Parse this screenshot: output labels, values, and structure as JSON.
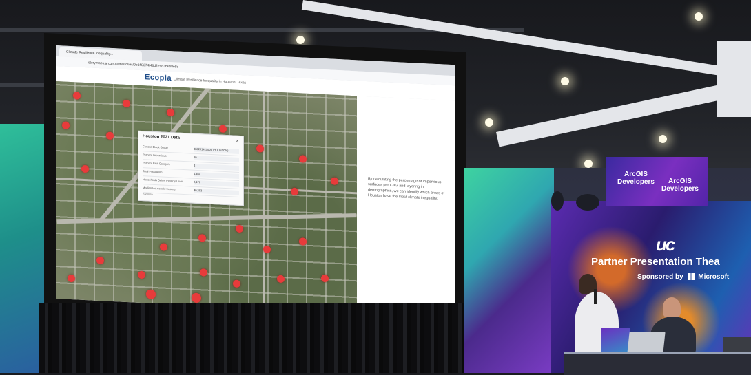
{
  "browser": {
    "tab_title": "Climate Resilience Inequality...",
    "url": "storymaps.arcgis.com/stories/9b1ff8274f46d2e9d3b6b8e8c"
  },
  "storymap": {
    "logo": "Ecopia",
    "title": "Climate Resilience Inequality in Houston, Texas"
  },
  "popup": {
    "title": "Houston 2021 Data",
    "rows": [
      {
        "label": "Census Block Group",
        "value": "480201421004 (HOUSTON)"
      },
      {
        "label": "Percent Impervious",
        "value": "80"
      },
      {
        "label": "Percent Risk Category",
        "value": "4"
      },
      {
        "label": "Total Population",
        "value": "1,450"
      },
      {
        "label": "Households Below Poverty Level",
        "value": "2,176"
      },
      {
        "label": "Median Household Income",
        "value": "$0,293"
      }
    ],
    "footer": "Zoom to"
  },
  "side_panel": {
    "text": "By calculating the percentage of impervious surfaces per CBG and layering in demographics, we can identify which areas of Houston have the most climate inequality."
  },
  "booth": {
    "sign_line1": "ArcGIS",
    "sign_line2": "Developers",
    "uc_logo": "uc",
    "title": "Partner Presentation Thea",
    "sponsor_prefix": "Sponsored by",
    "sponsor_name": "Microsoft"
  },
  "colors": {
    "hotspot": "#e83b3b",
    "booth_purple": "#5b2bb0",
    "booth_teal": "#3ed3a0"
  }
}
